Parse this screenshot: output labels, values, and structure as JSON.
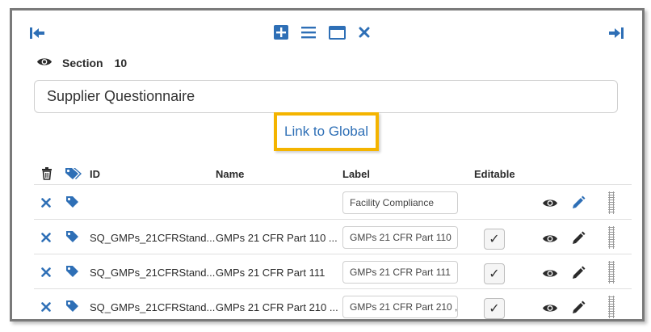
{
  "section": {
    "label": "Section",
    "number": "10"
  },
  "title_value": "Supplier Questionnaire",
  "link_label": "Link to Global",
  "columns": {
    "id": "ID",
    "name": "Name",
    "label": "Label",
    "editable": "Editable"
  },
  "rows": [
    {
      "id": "",
      "name": "",
      "label": "Facility Compliance",
      "editable": false,
      "checked": false
    },
    {
      "id": "SQ_GMPs_21CFRStand...",
      "name": "GMPs 21 CFR Part 110 ...",
      "label": "GMPs 21 CFR Part 110",
      "editable": true,
      "checked": true
    },
    {
      "id": "SQ_GMPs_21CFRStand...",
      "name": "GMPs 21 CFR Part 111",
      "label": "GMPs 21 CFR Part 111",
      "editable": true,
      "checked": true
    },
    {
      "id": "SQ_GMPs_21CFRStand...",
      "name": "GMPs 21 CFR Part 210 ...",
      "label": "GMPs 21 CFR Part 210 ,",
      "editable": true,
      "checked": true
    }
  ],
  "icons": [
    "collapse-left-icon",
    "add-icon",
    "list-icon",
    "window-icon",
    "close-icon",
    "expand-right-icon",
    "eye-icon",
    "trash-icon",
    "tags-icon",
    "tag-icon",
    "pencil-icon",
    "drag-handle-icon"
  ],
  "colors": {
    "accent": "#2e6fb6",
    "highlight": "#f4b400",
    "frame": "#7a7a7a"
  }
}
